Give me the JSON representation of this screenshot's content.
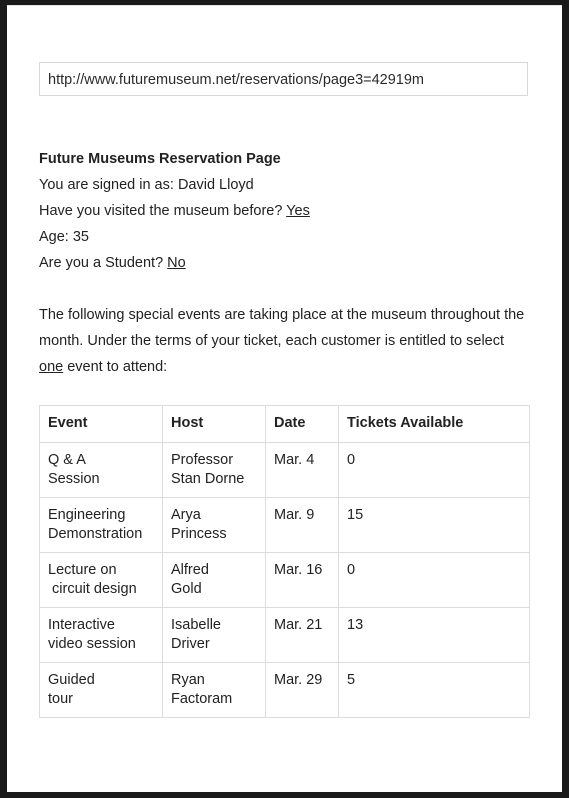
{
  "url": "http://www.futuremuseum.net/reservations/page3=42919m",
  "reservation": {
    "title": "Future Museums Reservation Page",
    "signed_in_prefix": "You are signed in as: ",
    "signed_in_name": "David Lloyd",
    "visited_question": "Have you visited the museum before? ",
    "visited_answer": "Yes",
    "age_label": "Age: ",
    "age_value": "35",
    "student_question": "Are you a Student? ",
    "student_answer": "No"
  },
  "intro": {
    "text_before": "The following special events are taking place at the museum throughout the month. Under the terms of your ticket, each customer is entitled to select ",
    "emphasis": "one",
    "text_after": " event to attend:"
  },
  "table": {
    "headers": [
      "Event",
      "Host",
      "Date",
      "Tickets Available"
    ],
    "rows": [
      {
        "event": [
          "Q & A",
          "Session"
        ],
        "host": [
          "Professor",
          "Stan Dorne"
        ],
        "date": "Mar. 4",
        "tickets": "0"
      },
      {
        "event": [
          "Engineering",
          "Demonstration"
        ],
        "host": [
          "Arya",
          "Princess"
        ],
        "date": "Mar. 9",
        "tickets": "15"
      },
      {
        "event": [
          "Lecture on",
          " circuit design"
        ],
        "host": [
          "Alfred",
          "Gold"
        ],
        "date": "Mar. 16",
        "tickets": "0"
      },
      {
        "event": [
          "Interactive",
          "video session"
        ],
        "host": [
          "Isabelle",
          "Driver"
        ],
        "date": "Mar. 21",
        "tickets": "13"
      },
      {
        "event": [
          "Guided",
          "tour"
        ],
        "host": [
          "Ryan",
          "Factoram"
        ],
        "date": "Mar. 29",
        "tickets": "5"
      }
    ]
  }
}
